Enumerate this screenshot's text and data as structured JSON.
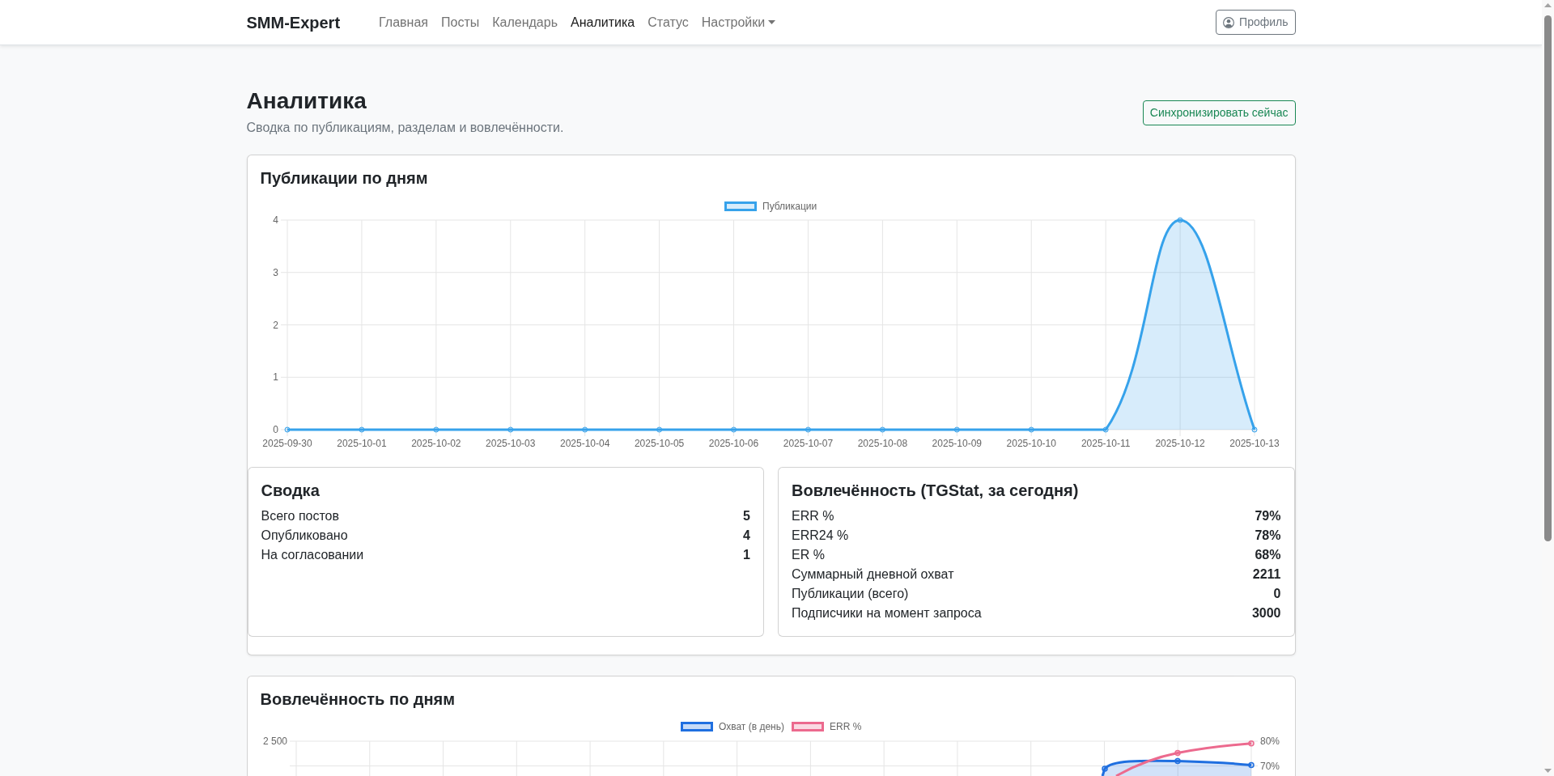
{
  "navbar": {
    "brand": "SMM-Expert",
    "links": [
      {
        "label": "Главная",
        "kind": "link",
        "selected": false
      },
      {
        "label": "Посты",
        "kind": "link",
        "selected": false
      },
      {
        "label": "Календарь",
        "kind": "link",
        "selected": false
      },
      {
        "label": "Аналитика",
        "kind": "link",
        "selected": true
      },
      {
        "label": "Статус",
        "kind": "link",
        "selected": false
      },
      {
        "label": "Настройки",
        "kind": "dropdown",
        "selected": false
      }
    ],
    "profile_button": "Профиль"
  },
  "header": {
    "title": "Аналитика",
    "subtitle": "Сводка по публикациям, разделам и вовлечённости.",
    "sync_button": "Синхронизировать сейчас"
  },
  "publications_card": {
    "title": "Публикации по дням",
    "chart_data": {
      "type": "area",
      "categories": [
        "2025-09-30",
        "2025-10-01",
        "2025-10-02",
        "2025-10-03",
        "2025-10-04",
        "2025-10-05",
        "2025-10-06",
        "2025-10-07",
        "2025-10-08",
        "2025-10-09",
        "2025-10-10",
        "2025-10-11",
        "2025-10-12",
        "2025-10-13"
      ],
      "series": [
        {
          "name": "Публикации",
          "color": "#36a2eb",
          "values": [
            0,
            0,
            0,
            0,
            0,
            0,
            0,
            0,
            0,
            0,
            0,
            0,
            4,
            0
          ]
        }
      ],
      "ylim": [
        0,
        4
      ],
      "yticks": [
        0,
        1,
        2,
        3,
        4
      ],
      "grid": true
    }
  },
  "summary_card": {
    "title": "Сводка",
    "rows": [
      {
        "label": "Всего постов",
        "value": "5"
      },
      {
        "label": "Опубликовано",
        "value": "4"
      },
      {
        "label": "На согласовании",
        "value": "1"
      }
    ]
  },
  "engagement_card": {
    "title": "Вовлечённость (TGStat, за сегодня)",
    "rows": [
      {
        "label": "ERR %",
        "value": "79%"
      },
      {
        "label": "ERR24 %",
        "value": "78%"
      },
      {
        "label": "ER %",
        "value": "68%"
      },
      {
        "label": "Суммарный дневной охват",
        "value": "2211"
      },
      {
        "label": "Публикации (всего)",
        "value": "0"
      },
      {
        "label": "Подписчики на момент запроса",
        "value": "3000"
      }
    ]
  },
  "engagement_by_day_card": {
    "title": "Вовлечённость по дням",
    "legend": [
      {
        "label": "Охват (в день)",
        "color": "#1f6fe0"
      },
      {
        "label": "ERR %",
        "color": "#ec6a8e"
      }
    ],
    "left_axis_ticks": [
      "2 500"
    ],
    "right_axis_ticks": [
      "80%",
      "70%"
    ]
  }
}
